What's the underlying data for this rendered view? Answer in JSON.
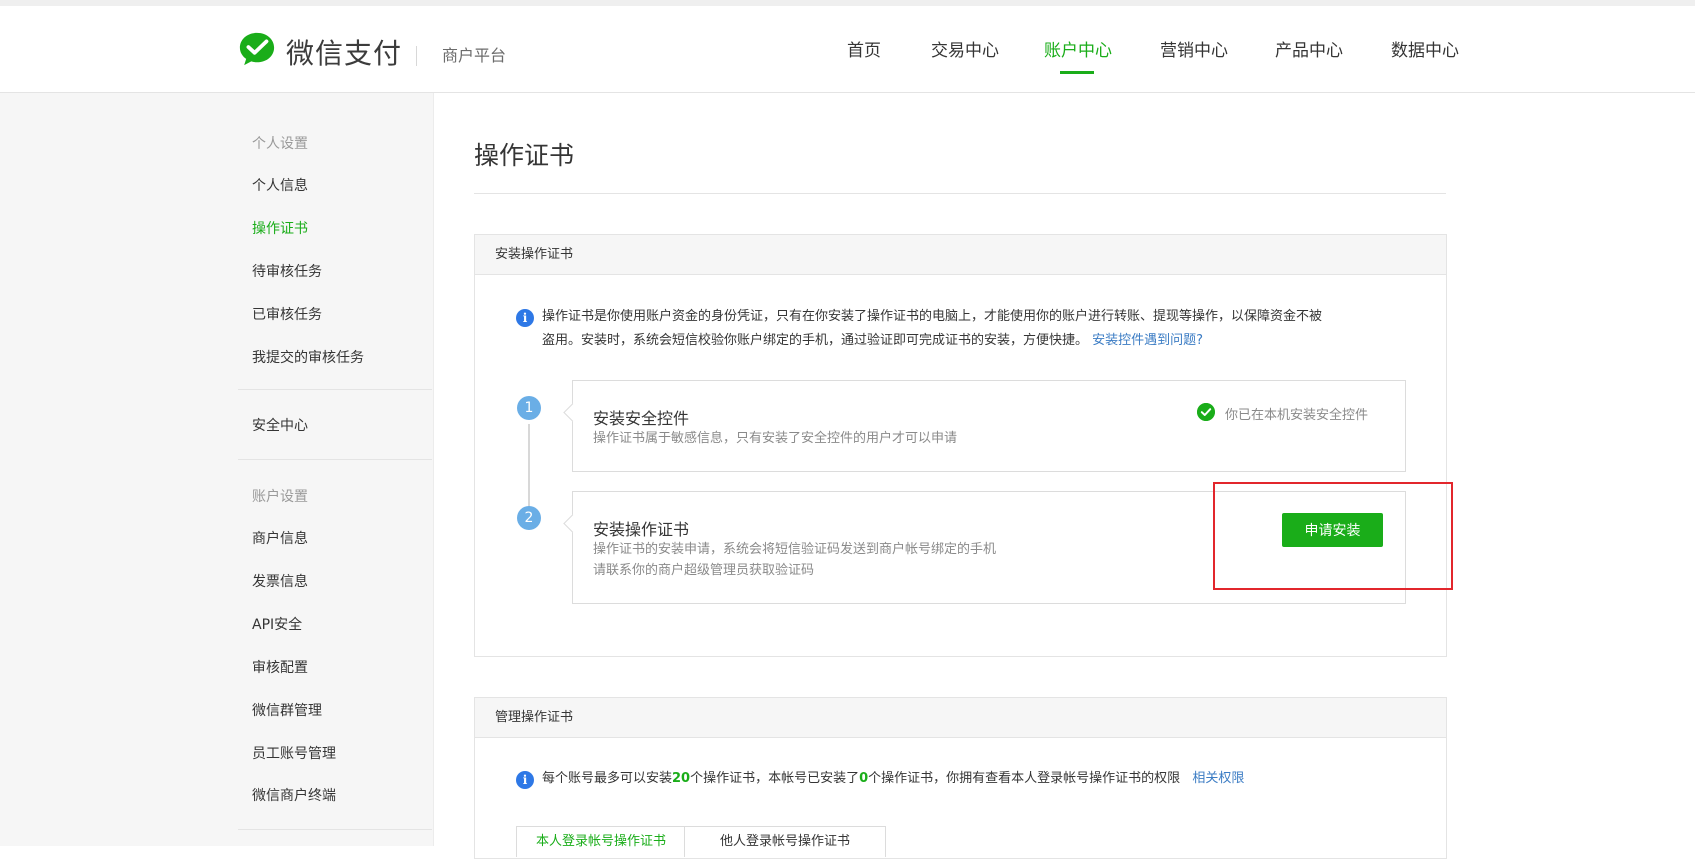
{
  "header": {
    "brand": "微信支付",
    "platform": "商户平台",
    "nav": [
      "首页",
      "交易中心",
      "账户中心",
      "营销中心",
      "产品中心",
      "数据中心"
    ],
    "active_nav": "账户中心"
  },
  "sidebar": {
    "personal_group": "个人设置",
    "personal_items": [
      "个人信息",
      "操作证书",
      "待审核任务",
      "已审核任务",
      "我提交的审核任务"
    ],
    "active_item": "操作证书",
    "security_center": "安全中心",
    "account_group": "账户设置",
    "account_items": [
      "商户信息",
      "发票信息",
      "API安全",
      "审核配置",
      "微信群管理",
      "员工账号管理",
      "微信商户终端"
    ]
  },
  "main": {
    "title": "操作证书",
    "install_panel": {
      "heading": "安装操作证书",
      "info_line1": "操作证书是你使用账户资金的身份凭证，只有在你安装了操作证书的电脑上，才能使用你的账户进行转账、提现等操作，以保障资金不被",
      "info_line2": "盗用。安装时，系统会短信校验你账户绑定的手机，通过验证即可完成证书的安装，方便快捷。",
      "info_link": "安装控件遇到问题?",
      "steps": [
        {
          "number": "1",
          "title": "安装安全控件",
          "desc1": "操作证书属于敏感信息，只有安装了安全控件的用户才可以申请",
          "status": "你已在本机安装安全控件"
        },
        {
          "number": "2",
          "title": "安装操作证书",
          "desc1": "操作证书的安装申请，系统会将短信验证码发送到商户帐号绑定的手机",
          "desc2": "请联系你的商户超级管理员获取验证码",
          "button": "申请安装"
        }
      ]
    },
    "manage_panel": {
      "heading": "管理操作证书",
      "info_part1": "每个账号最多可以安装",
      "max_count": "20",
      "info_part2": "个操作证书，本帐号已安装了",
      "installed_count": "0",
      "info_part3": "个操作证书，你拥有查看本人登录帐号操作证书的权限",
      "info_link": "相关权限",
      "tabs": [
        "本人登录帐号操作证书",
        "他人登录帐号操作证书"
      ]
    }
  },
  "colors": {
    "brand_green": "#1aad19",
    "link_blue": "#3b7cc4",
    "highlight_red": "#e2262c",
    "info_blue": "#2e78e6"
  }
}
